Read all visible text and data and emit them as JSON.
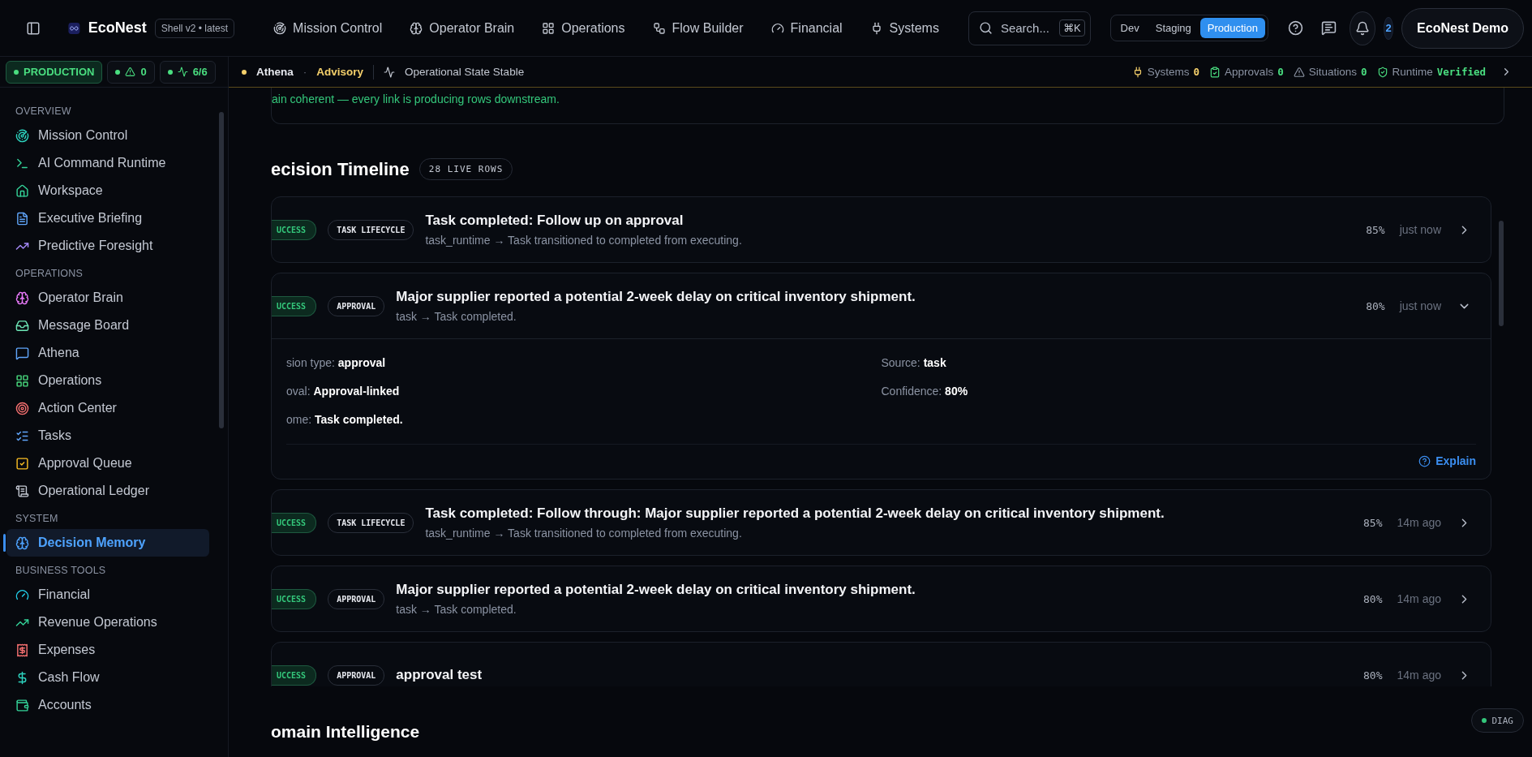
{
  "top_bar": {
    "app_name": "EcoNest",
    "version": "Shell v2 • latest",
    "nav": [
      {
        "label": "Mission Control",
        "selected": false
      },
      {
        "label": "Operator Brain",
        "selected": false
      },
      {
        "label": "Operations",
        "selected": false
      },
      {
        "label": "Flow Builder",
        "selected": false
      },
      {
        "label": "Financial",
        "selected": false
      },
      {
        "label": "Systems",
        "selected": false
      }
    ],
    "search": {
      "placeholder": "Search...",
      "shortcut": "⌘K"
    },
    "environments": [
      {
        "label": "Dev",
        "selected": false
      },
      {
        "label": "Staging",
        "selected": false
      },
      {
        "label": "Production",
        "selected": true
      }
    ],
    "notification_count": "2",
    "workspace": "EcoNest Demo"
  },
  "sidebar": {
    "env_badge": "PRODUCTION",
    "alerts": "0",
    "health": "6/6",
    "sections": [
      {
        "title": "OVERVIEW",
        "items": [
          {
            "label": "Mission Control",
            "selected": false
          },
          {
            "label": "AI Command Runtime",
            "selected": false
          },
          {
            "label": "Workspace",
            "selected": false
          },
          {
            "label": "Executive Briefing",
            "selected": false
          },
          {
            "label": "Predictive Foresight",
            "selected": false
          }
        ]
      },
      {
        "title": "OPERATIONS",
        "items": [
          {
            "label": "Operator Brain",
            "selected": false
          },
          {
            "label": "Message Board",
            "selected": false
          },
          {
            "label": "Athena",
            "selected": false
          },
          {
            "label": "Operations",
            "selected": false
          },
          {
            "label": "Action Center",
            "selected": false
          },
          {
            "label": "Tasks",
            "selected": false
          },
          {
            "label": "Approval Queue",
            "selected": false
          },
          {
            "label": "Operational Ledger",
            "selected": false
          }
        ]
      },
      {
        "title": "SYSTEM",
        "items": [
          {
            "label": "Decision Memory",
            "selected": true
          }
        ]
      },
      {
        "title": "BUSINESS TOOLS",
        "items": [
          {
            "label": "Financial",
            "selected": false
          },
          {
            "label": "Revenue Operations",
            "selected": false
          },
          {
            "label": "Expenses",
            "selected": false
          },
          {
            "label": "Cash Flow",
            "selected": false
          },
          {
            "label": "Accounts",
            "selected": false
          }
        ]
      }
    ]
  },
  "status_bar": {
    "agent": "Athena",
    "separator": "·",
    "mode": "Advisory",
    "state": "Operational State Stable",
    "indicators": [
      {
        "label": "Systems",
        "value": "0",
        "color": "#f5d06b"
      },
      {
        "label": "Approvals",
        "value": "0",
        "color": "#4ade80"
      },
      {
        "label": "Situations",
        "value": "0",
        "color": "#4ade80"
      },
      {
        "label": "Runtime",
        "value": "Verified",
        "color": "#4ade80"
      }
    ]
  },
  "banner": {
    "text": "ain coherent — every link is producing rows downstream."
  },
  "timeline": {
    "title": "ecision Timeline",
    "count": "28 LIVE ROWS",
    "rows": [
      {
        "status": "UCCESS",
        "category": "TASK LIFECYCLE",
        "title": "Task completed: Follow up on approval",
        "subtitle": "task_runtime → Task transitioned to completed from executing.",
        "confidence": "85%",
        "time": "just now",
        "expanded": false
      },
      {
        "status": "UCCESS",
        "category": "APPROVAL",
        "title": "Major supplier reported a potential 2-week delay on critical inventory shipment.",
        "subtitle": "task → Task completed.",
        "confidence": "80%",
        "time": "just now",
        "expanded": true,
        "details": {
          "left": [
            {
              "label": "sion type:",
              "value": "approval"
            },
            {
              "label": "oval:",
              "value": "Approval-linked"
            },
            {
              "label": "ome:",
              "value": "Task completed."
            }
          ],
          "right": [
            {
              "label": "Source:",
              "value": "task"
            },
            {
              "label": "Confidence:",
              "value": "80%"
            }
          ],
          "action": "Explain"
        }
      },
      {
        "status": "UCCESS",
        "category": "TASK LIFECYCLE",
        "title": "Task completed: Follow through: Major supplier reported a potential 2-week delay on critical inventory shipment.",
        "subtitle": "task_runtime → Task transitioned to completed from executing.",
        "confidence": "85%",
        "time": "14m ago",
        "expanded": false
      },
      {
        "status": "UCCESS",
        "category": "APPROVAL",
        "title": "Major supplier reported a potential 2-week delay on critical inventory shipment.",
        "subtitle": "task → Task completed.",
        "confidence": "80%",
        "time": "14m ago",
        "expanded": false
      },
      {
        "status": "UCCESS",
        "category": "APPROVAL",
        "title": "approval test",
        "confidence": "80%",
        "time": "14m ago",
        "expanded": false
      }
    ]
  },
  "next_section": {
    "title": "omain Intelligence"
  },
  "diag": "DIAG"
}
